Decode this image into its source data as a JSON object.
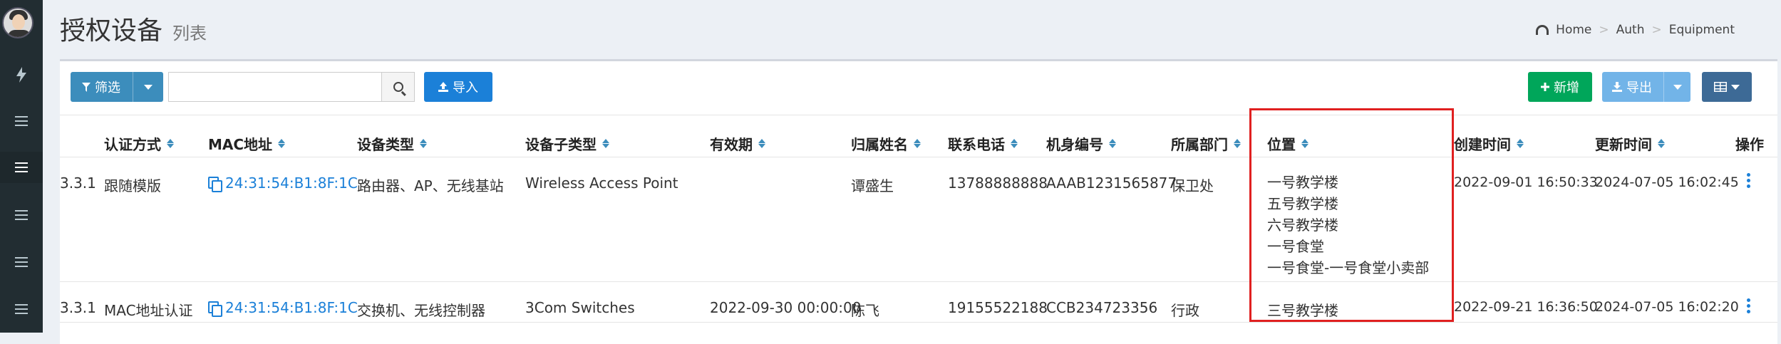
{
  "sidebar": {
    "avatar": "user-avatar",
    "items": [
      "lightning-icon",
      "menu-icon",
      "menu-icon",
      "menu-icon",
      "menu-icon",
      "menu-icon"
    ]
  },
  "header": {
    "title": "授权设备",
    "subtitle": "列表"
  },
  "breadcrumb": {
    "home": "Home",
    "auth": "Auth",
    "equipment": "Equipment"
  },
  "toolbar": {
    "filter_label": "筛选",
    "import_label": "导入",
    "add_label": "新增",
    "export_label": "导出",
    "search_value": ""
  },
  "table": {
    "headers": [
      "认证方式",
      "MAC地址",
      "设备类型",
      "设备子类型",
      "有效期",
      "归属姓名",
      "联系电话",
      "机身编号",
      "所属部门",
      "位置",
      "创建时间",
      "更新时间",
      "操作"
    ],
    "rows": [
      {
        "ip_fragment": "3.3.1",
        "auth": "跟随模版",
        "mac": "24:31:54:B1:8F:1C",
        "type": "路由器、AP、无线基站",
        "subtype": "Wireless Access Point",
        "validity": "",
        "owner": "谭盛生",
        "phone": "13788888888",
        "serial": "AAAB1231565877",
        "dept": "保卫处",
        "locations": [
          "一号教学楼",
          "五号教学楼",
          "六号教学楼",
          "一号食堂",
          "一号食堂-一号食堂小卖部"
        ],
        "created": "2022-09-01 16:50:33",
        "updated": "2024-07-05 16:02:45"
      },
      {
        "ip_fragment": "3.3.1",
        "auth": "MAC地址认证",
        "mac": "24:31:54:B1:8F:1C",
        "type": "交换机、无线控制器",
        "subtype": "3Com Switches",
        "validity": "2022-09-30 00:00:00",
        "owner": "陈飞",
        "phone": "19155522188",
        "serial": "CCB234723356",
        "dept": "行政",
        "locations": [
          "三号教学楼"
        ],
        "created": "2022-09-21 16:36:50",
        "updated": "2024-07-05 16:02:20"
      }
    ]
  },
  "colors": {
    "sidebar": "#222d32",
    "primary": "#3c8dbc",
    "link": "#1b80d8",
    "success": "#00a65a",
    "highlight": "#e02020"
  }
}
